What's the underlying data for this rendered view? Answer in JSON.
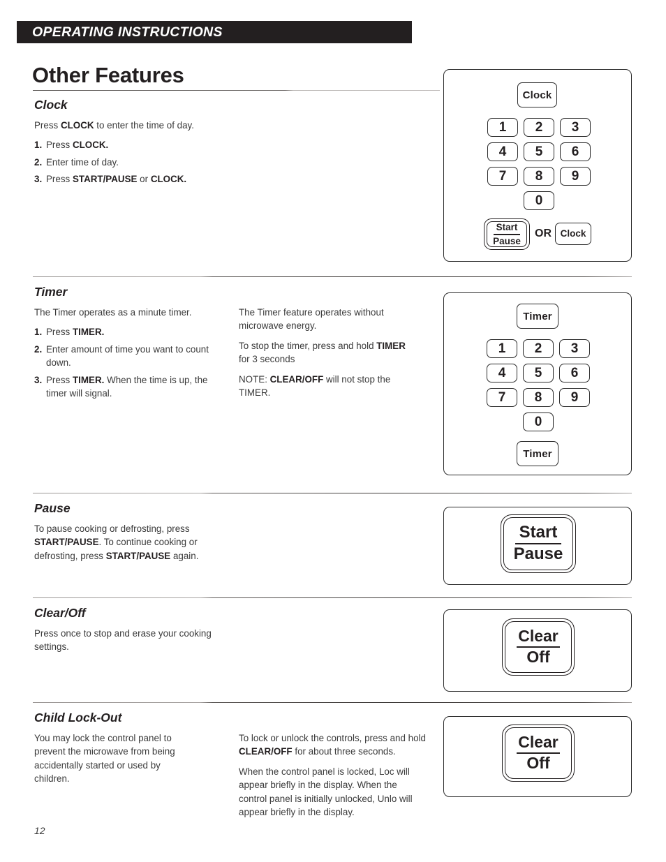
{
  "header": {
    "running_title": "OPERATING INSTRUCTIONS"
  },
  "page_title": "Other Features",
  "page_number": "12",
  "colors": {
    "header_bar": "#231f20",
    "text": "#3a3a3a",
    "heading": "#231f20",
    "rule": "#55514f"
  },
  "sections": [
    {
      "id": "clock",
      "heading": "Clock",
      "intro": "Press CLOCK to enter the time of day.",
      "intro_parts": {
        "a": "Press ",
        "b": "CLOCK",
        "c": " to enter the time of day."
      },
      "steps": [
        {
          "num": "1.",
          "a": "Press ",
          "b": "CLOCK.",
          "c": ""
        },
        {
          "num": "2.",
          "a": "Enter time of day.",
          "b": "",
          "c": ""
        },
        {
          "num": "3.",
          "a": "Press ",
          "b": "START/PAUSE",
          "c": " or ",
          "d": "CLOCK."
        }
      ],
      "diagram": {
        "top_key": "Clock",
        "keypad": [
          "1",
          "2",
          "3",
          "4",
          "5",
          "6",
          "7",
          "8",
          "9"
        ],
        "zero_key": "0",
        "bottom_primary_top": "Start",
        "bottom_primary_bottom": "Pause",
        "or_label": "OR",
        "bottom_alt_key": "Clock"
      }
    },
    {
      "id": "timer",
      "heading": "Timer",
      "intro": "The Timer operates as a minute timer.",
      "steps": [
        {
          "num": "1.",
          "a": "Press ",
          "b": "TIMER.",
          "c": ""
        },
        {
          "num": "2.",
          "a": "Enter amount of time you want to count down.",
          "b": "",
          "c": ""
        },
        {
          "num": "3.",
          "a": "Press ",
          "b": "TIMER.",
          "c": " When the time is up, the timer will signal."
        }
      ],
      "right_col": {
        "p1": "The Timer feature operates without microwave energy.",
        "p2_a": "To stop the timer, press and hold ",
        "p2_b": "TIMER",
        "p2_c": " for 3 seconds",
        "p3_a": "NOTE: ",
        "p3_b": "CLEAR/OFF",
        "p3_c": " will not stop the TIMER."
      },
      "diagram": {
        "top_key": "Timer",
        "keypad": [
          "1",
          "2",
          "3",
          "4",
          "5",
          "6",
          "7",
          "8",
          "9"
        ],
        "zero_key": "0",
        "bottom_key": "Timer"
      }
    },
    {
      "id": "pause",
      "heading": "Pause",
      "body_a": "To pause cooking or defrosting, press ",
      "body_b": "START/PAUSE",
      "body_c": ". To continue cooking or defrosting, press ",
      "body_d": "START/PAUSE",
      "body_e": " again.",
      "diagram": {
        "button_top": "Start",
        "button_bottom": "Pause"
      }
    },
    {
      "id": "clear-off",
      "heading": "Clear/Off",
      "body": "Press once to stop and erase your cooking settings.",
      "diagram": {
        "button_top": "Clear",
        "button_bottom": "Off"
      }
    },
    {
      "id": "child-lock-out",
      "heading": "Child Lock-Out",
      "left_body": "You may lock the control panel to prevent the microwave from being accidentally started or used by children.",
      "right_col": {
        "p1_a": "To lock or unlock the controls, press and hold ",
        "p1_b": "CLEAR/OFF",
        "p1_c": " for about three seconds.",
        "p2": "When the control panel is locked, Loc will appear briefly in the display. When the control panel is initially unlocked, Unlo will appear briefly in the display."
      },
      "diagram": {
        "button_top": "Clear",
        "button_bottom": "Off"
      }
    }
  ]
}
